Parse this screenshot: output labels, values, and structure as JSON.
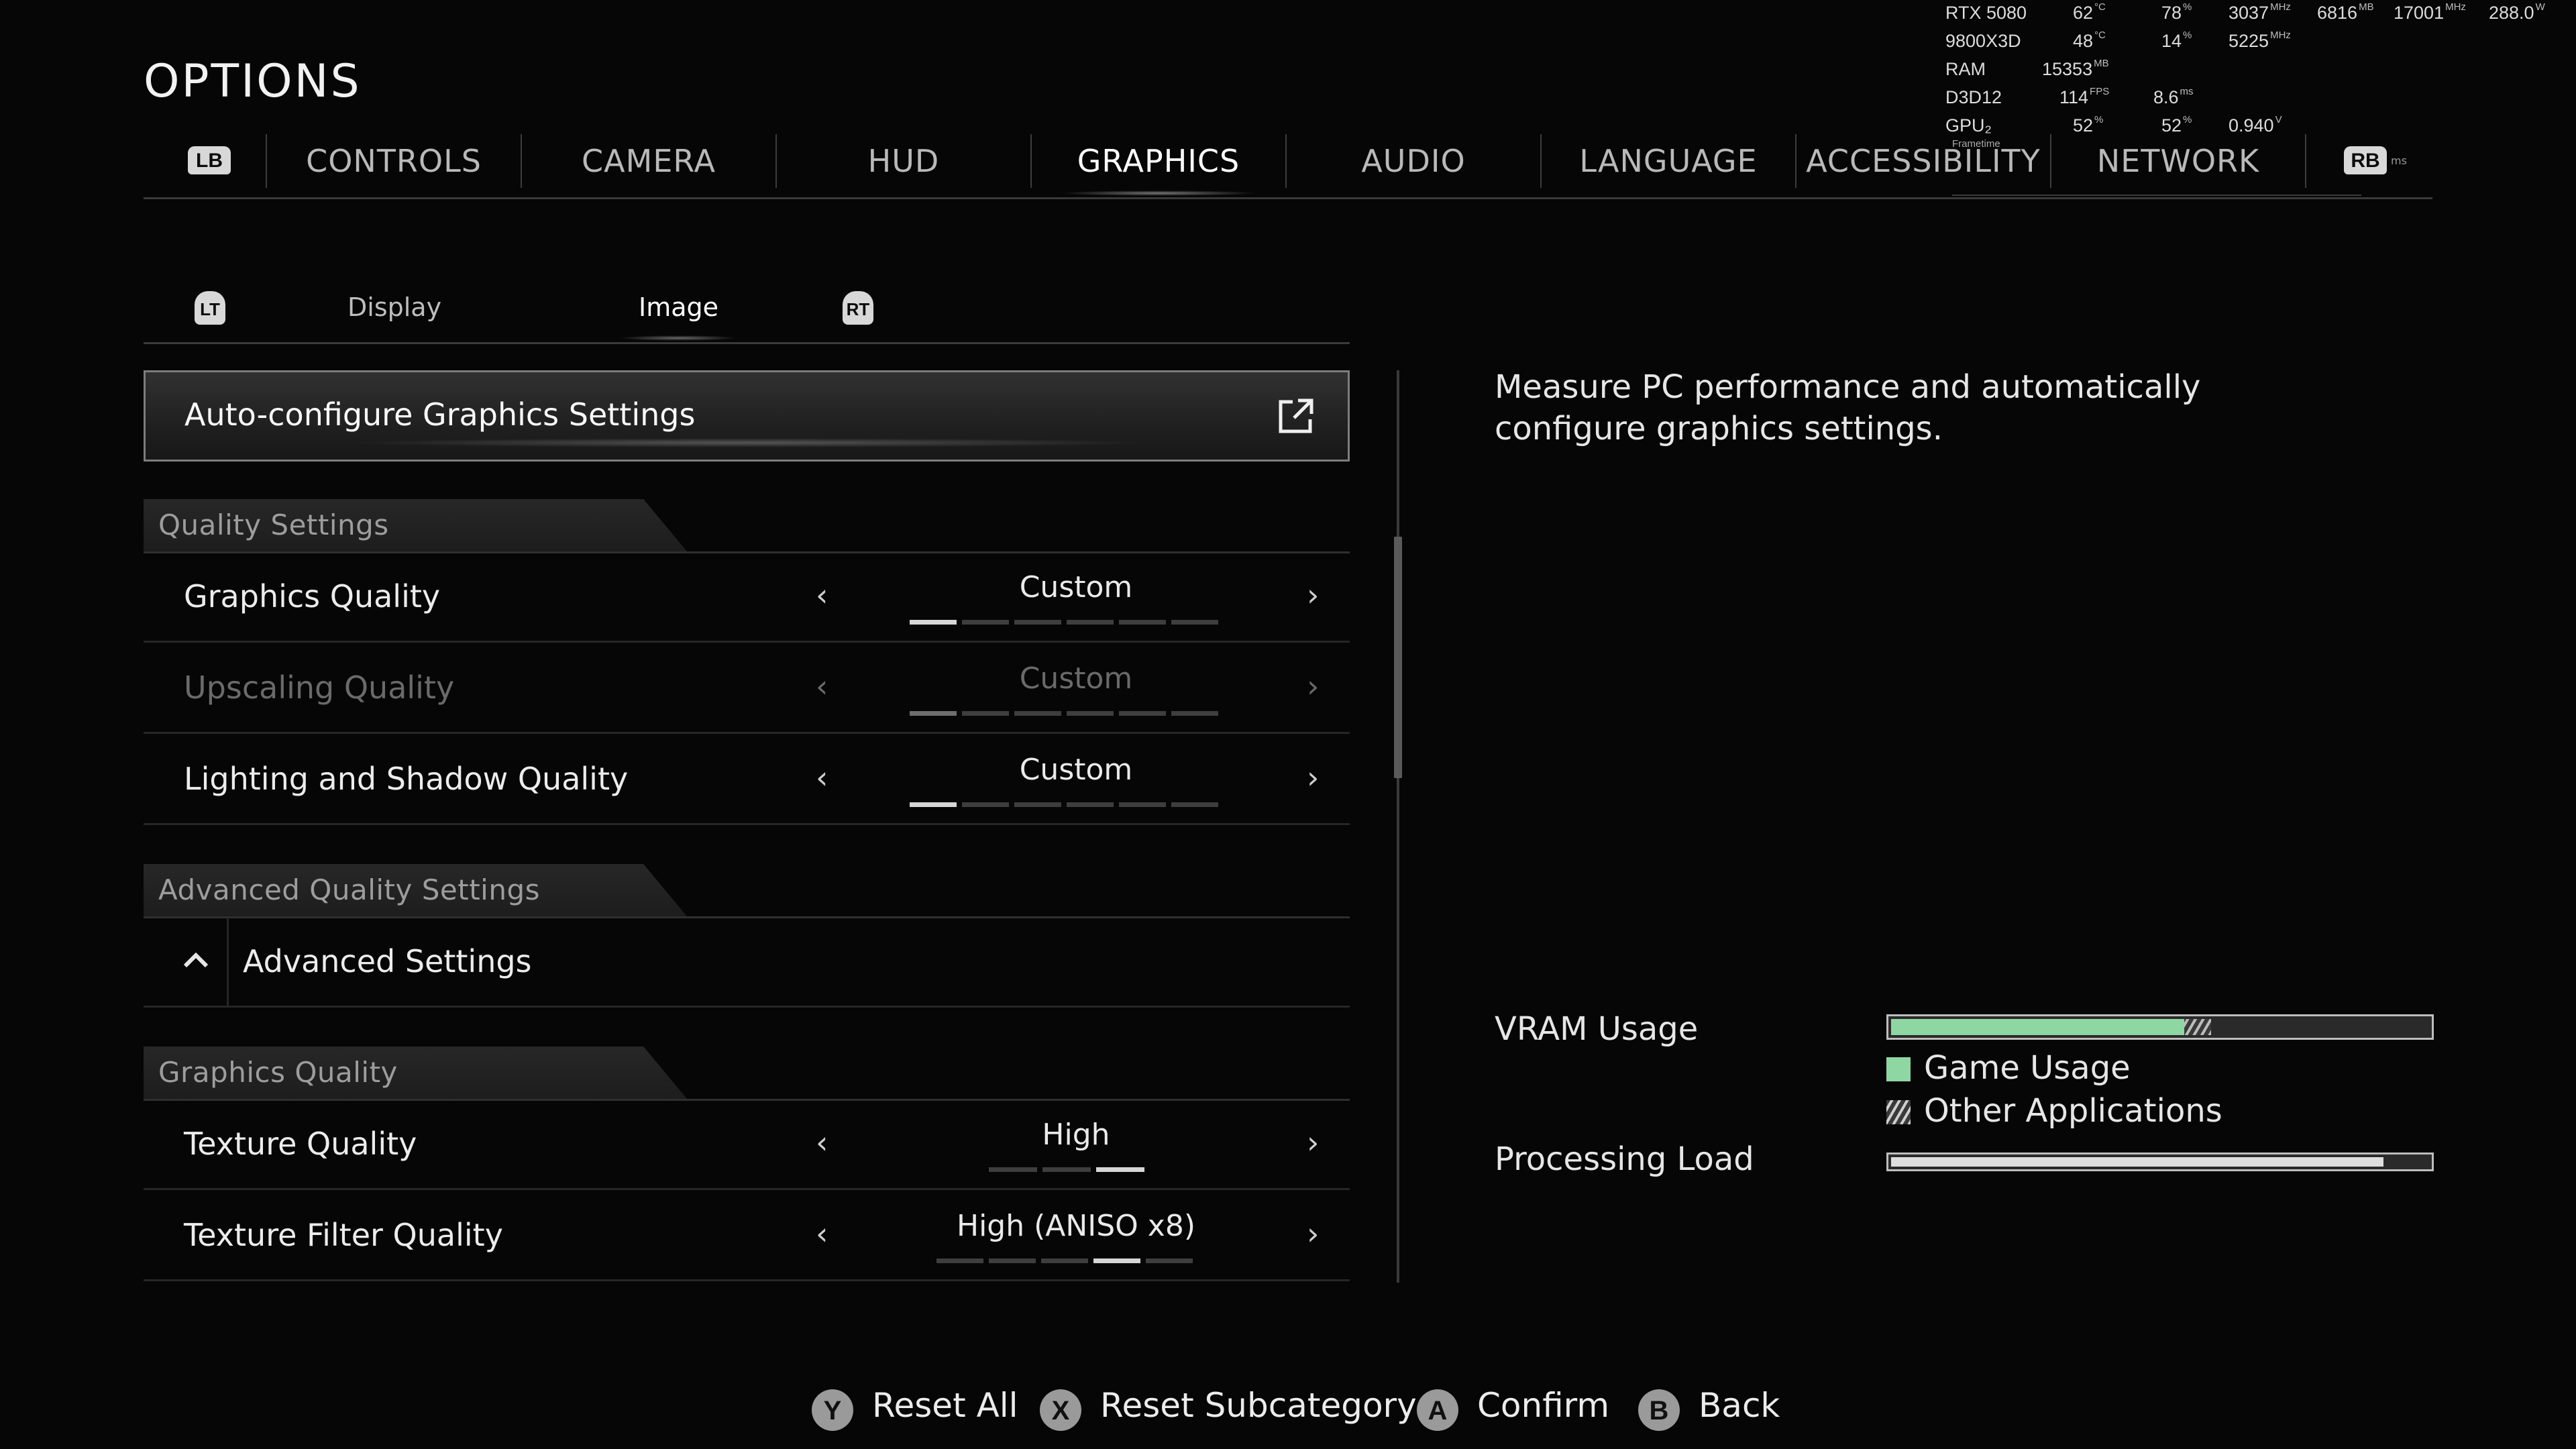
{
  "overlay": {
    "rows": [
      [
        "RTX 5080",
        "62",
        "°C",
        "78",
        "%",
        "3037",
        "MHz",
        "6816",
        "MB",
        "17001",
        "MHz",
        "288.0",
        "W"
      ],
      [
        "9800X3D",
        "48",
        "°C",
        "14",
        "%",
        "5225",
        "MHz"
      ],
      [
        "RAM",
        "15353",
        "MB"
      ],
      [
        "D3D12",
        "114",
        "FPS",
        "8.6",
        "ms"
      ],
      [
        "GPU₂",
        "52",
        "%",
        "52",
        "%",
        "0.940",
        "V"
      ]
    ],
    "frametime_label": "Frametime",
    "rb_ms": "ms"
  },
  "page_title": "OPTIONS",
  "tabs": {
    "lb": "LB",
    "rb": "RB",
    "items": [
      "CONTROLS",
      "CAMERA",
      "HUD",
      "GRAPHICS",
      "AUDIO",
      "LANGUAGE",
      "ACCESSIBILITY",
      "NETWORK"
    ],
    "active_index": 3
  },
  "subtabs": {
    "lt": "LT",
    "rt": "RT",
    "items": [
      "Display",
      "Image"
    ],
    "active_index": 1
  },
  "auto_config": {
    "label": "Auto-configure Graphics Settings",
    "icon": "external-link-icon"
  },
  "sections": [
    {
      "title": "Quality Settings"
    },
    {
      "title": "Advanced Quality Settings"
    },
    {
      "title": "Graphics Quality"
    }
  ],
  "settings": [
    {
      "label": "Graphics Quality",
      "value": "Custom",
      "segments": 6,
      "active": 0,
      "disabled": false
    },
    {
      "label": "Upscaling Quality",
      "value": "Custom",
      "segments": 6,
      "active": 0,
      "disabled": true
    },
    {
      "label": "Lighting and Shadow Quality",
      "value": "Custom",
      "segments": 6,
      "active": 0,
      "disabled": false
    },
    {
      "label": "Texture Quality",
      "value": "High",
      "segments": 3,
      "active": 2,
      "disabled": false
    },
    {
      "label": "Texture Filter Quality",
      "value": "High (ANISO x8)",
      "segments": 5,
      "active": 3,
      "disabled": false
    }
  ],
  "advanced": {
    "label": "Advanced Settings",
    "icon": "chevron-up-icon"
  },
  "description": "Measure PC performance and automatically configure graphics settings.",
  "metrics": {
    "vram_label": "VRAM Usage",
    "vram_game_fraction": 0.545,
    "vram_other_fraction": 0.05,
    "legend_game": "Game Usage",
    "legend_other": "Other Applications",
    "load_label": "Processing Load",
    "load_fraction": 0.915,
    "colors": {
      "game": "#8fd7a2"
    }
  },
  "footer": [
    {
      "glyph": "Y",
      "label": "Reset All"
    },
    {
      "glyph": "X",
      "label": "Reset Subcategory"
    },
    {
      "glyph": "A",
      "label": "Confirm"
    },
    {
      "glyph": "B",
      "label": "Back"
    }
  ]
}
